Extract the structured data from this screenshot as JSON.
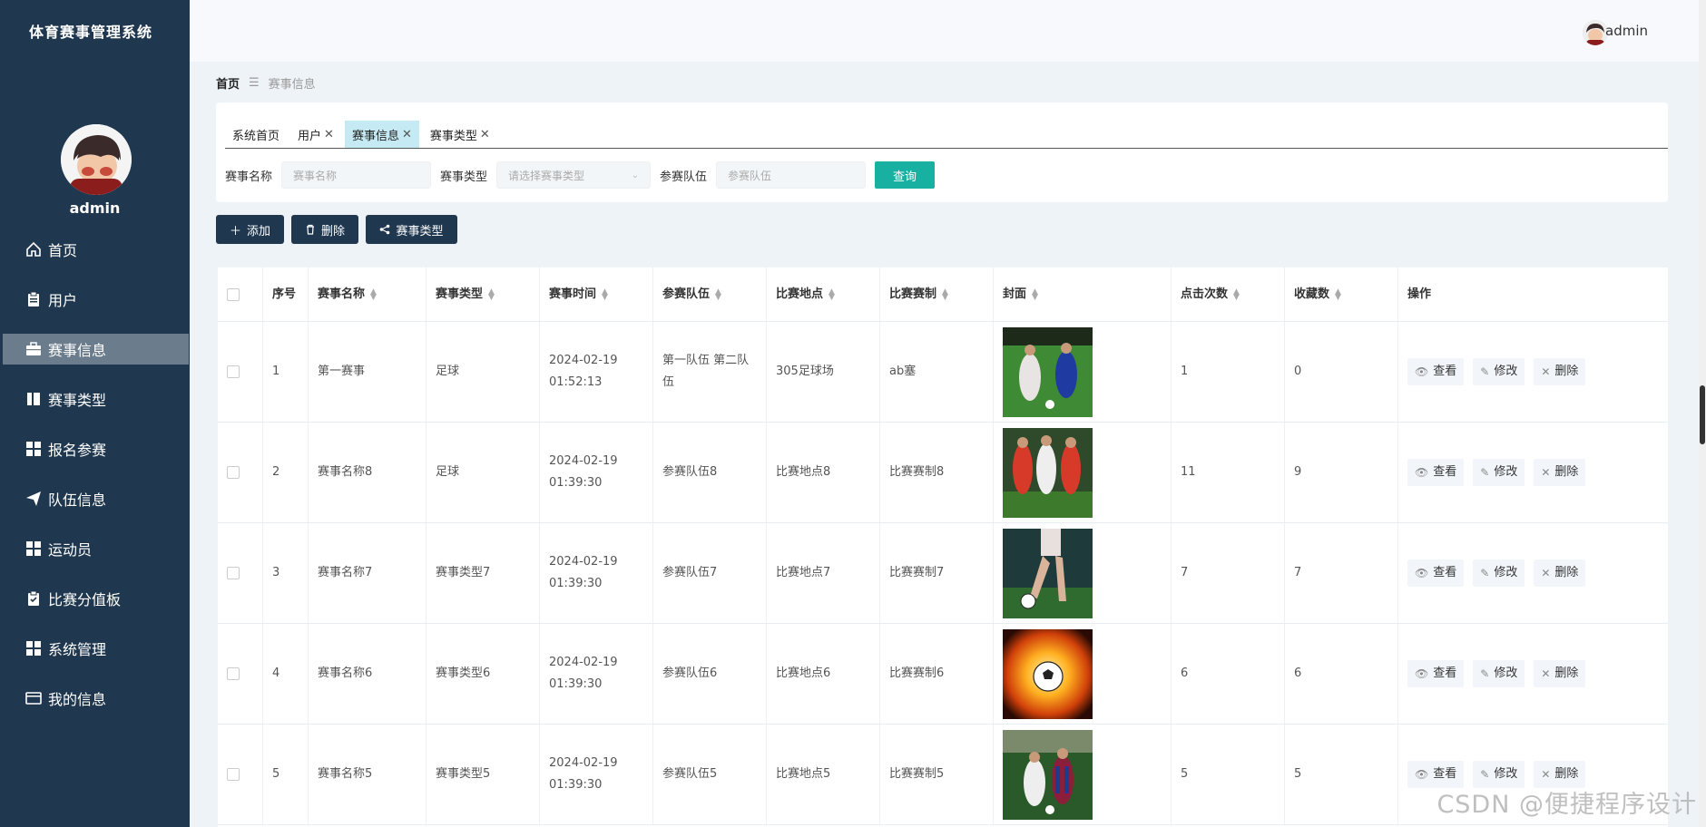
{
  "app_title": "体育赛事管理系统",
  "user": {
    "name": "admin"
  },
  "sidebar": {
    "items": [
      {
        "label": "首页",
        "icon": "home-icon"
      },
      {
        "label": "用户",
        "icon": "clipboard-icon"
      },
      {
        "label": "赛事信息",
        "icon": "briefcase-icon",
        "active": true
      },
      {
        "label": "赛事类型",
        "icon": "book-icon"
      },
      {
        "label": "报名参赛",
        "icon": "grid-icon"
      },
      {
        "label": "队伍信息",
        "icon": "send-icon"
      },
      {
        "label": "运动员",
        "icon": "grid-icon"
      },
      {
        "label": "比赛分值板",
        "icon": "clipboard-check-icon"
      },
      {
        "label": "系统管理",
        "icon": "grid-icon"
      },
      {
        "label": "我的信息",
        "icon": "card-icon"
      }
    ]
  },
  "breadcrumb": {
    "home": "首页",
    "current": "赛事信息"
  },
  "tabs": [
    {
      "label": "系统首页",
      "closable": false
    },
    {
      "label": "用户",
      "closable": true
    },
    {
      "label": "赛事信息",
      "closable": true,
      "active": true
    },
    {
      "label": "赛事类型",
      "closable": true
    }
  ],
  "search": {
    "name_label": "赛事名称",
    "name_placeholder": "赛事名称",
    "type_label": "赛事类型",
    "type_placeholder": "请选择赛事类型",
    "team_label": "参赛队伍",
    "team_placeholder": "参赛队伍",
    "query_label": "查询"
  },
  "toolbar": {
    "add": "添加",
    "delete": "删除",
    "type": "赛事类型"
  },
  "table": {
    "headers": [
      "序号",
      "赛事名称",
      "赛事类型",
      "赛事时间",
      "参赛队伍",
      "比赛地点",
      "比赛赛制",
      "封面",
      "点击次数",
      "收藏数",
      "操作"
    ],
    "actions": {
      "view": "查看",
      "edit": "修改",
      "delete": "删除"
    },
    "rows": [
      {
        "no": "1",
        "name": "第一赛事",
        "type": "足球",
        "time": "2024-02-19 01:52:13",
        "team": "第一队伍 第二队伍",
        "place": "305足球场",
        "format": "ab塞",
        "clicks": "1",
        "favs": "0"
      },
      {
        "no": "2",
        "name": "赛事名称8",
        "type": "足球",
        "time": "2024-02-19 01:39:30",
        "team": "参赛队伍8",
        "place": "比赛地点8",
        "format": "比赛赛制8",
        "clicks": "11",
        "favs": "9"
      },
      {
        "no": "3",
        "name": "赛事名称7",
        "type": "赛事类型7",
        "time": "2024-02-19 01:39:30",
        "team": "参赛队伍7",
        "place": "比赛地点7",
        "format": "比赛赛制7",
        "clicks": "7",
        "favs": "7"
      },
      {
        "no": "4",
        "name": "赛事名称6",
        "type": "赛事类型6",
        "time": "2024-02-19 01:39:30",
        "team": "参赛队伍6",
        "place": "比赛地点6",
        "format": "比赛赛制6",
        "clicks": "6",
        "favs": "6"
      },
      {
        "no": "5",
        "name": "赛事名称5",
        "type": "赛事类型5",
        "time": "2024-02-19 01:39:30",
        "team": "参赛队伍5",
        "place": "比赛地点5",
        "format": "比赛赛制5",
        "clicks": "5",
        "favs": "5"
      }
    ]
  },
  "watermark": "CSDN @便捷程序设计"
}
